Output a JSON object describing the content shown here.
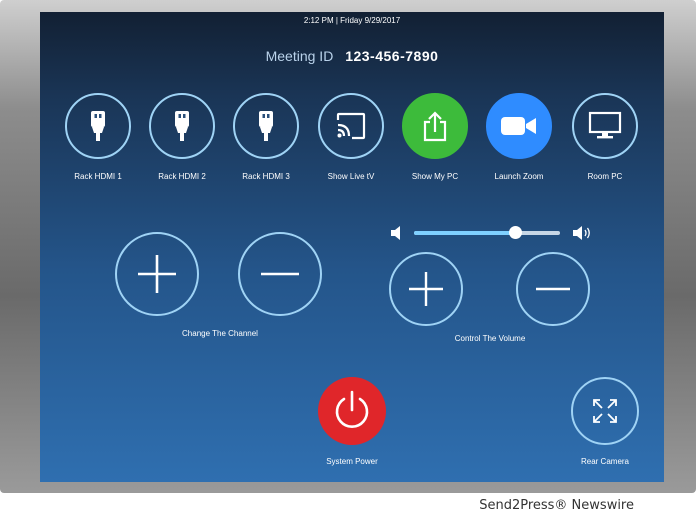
{
  "status_bar": {
    "text": "2:12 PM | Friday 9/29/2017"
  },
  "meeting": {
    "label": "Meeting ID",
    "value": "123-456-7890"
  },
  "sources": [
    {
      "label": "Rack HDMI 1",
      "icon": "hdmi-icon"
    },
    {
      "label": "Rack HDMI 2",
      "icon": "hdmi-icon"
    },
    {
      "label": "Rack HDMI 3",
      "icon": "hdmi-icon"
    },
    {
      "label": "Show Live tV",
      "icon": "cast-icon"
    },
    {
      "label": "Show My PC",
      "icon": "share-icon",
      "color": "#3dbb3b"
    },
    {
      "label": "Launch Zoom",
      "icon": "video-camera-icon",
      "color": "#2f8cff"
    },
    {
      "label": "Room PC",
      "icon": "monitor-icon"
    }
  ],
  "channel": {
    "label": "Change The Channel"
  },
  "volume": {
    "label": "Control The Volume",
    "level": 0.69
  },
  "power": {
    "label": "System Power",
    "color": "#e0262a"
  },
  "camera": {
    "label": "Rear Camera"
  },
  "footer": {
    "text": "Send2Press® Newswire"
  }
}
